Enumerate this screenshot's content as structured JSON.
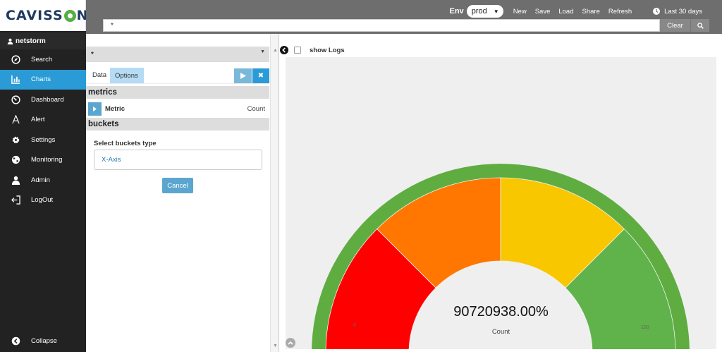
{
  "brand": {
    "name_left": "CAVISS",
    "name_right": "N"
  },
  "user": {
    "name": "netstorm"
  },
  "nav": {
    "items": [
      {
        "label": "Search",
        "icon": "compass-icon"
      },
      {
        "label": "Charts",
        "icon": "bar-chart-icon",
        "active": true
      },
      {
        "label": "Dashboard",
        "icon": "gauge-icon"
      },
      {
        "label": "Alert",
        "icon": "alert-icon"
      },
      {
        "label": "Settings",
        "icon": "gear-icon"
      },
      {
        "label": "Monitoring",
        "icon": "globe-icon"
      },
      {
        "label": "Admin",
        "icon": "user-icon"
      },
      {
        "label": "LogOut",
        "icon": "logout-icon"
      }
    ],
    "collapse_label": "Collapse"
  },
  "topbar": {
    "env_label": "Env",
    "env_value": "prod",
    "links": [
      "New",
      "Save",
      "Load",
      "Share",
      "Refresh"
    ],
    "time_range": "Last 30 days",
    "query_value": "*",
    "clear_label": "Clear"
  },
  "editor": {
    "title": "*",
    "tabs": {
      "data": "Data",
      "options": "Options"
    },
    "metrics_heading": "metrics",
    "metric_label": "Metric",
    "metric_agg": "Count",
    "buckets_heading": "buckets",
    "bucket_type_label": "Select buckets type",
    "bucket_option": "X-Axis",
    "cancel_label": "Cancel"
  },
  "viz": {
    "show_logs_label": "show Logs"
  },
  "chart_data": {
    "type": "gauge",
    "value_text": "90720938.00%",
    "label": "Count",
    "min_label": "0",
    "max_label": "100",
    "bands": [
      {
        "from": 0,
        "to": 25,
        "color": "#ff0000"
      },
      {
        "from": 25,
        "to": 50,
        "color": "#ff7700"
      },
      {
        "from": 50,
        "to": 75,
        "color": "#f8c700"
      },
      {
        "from": 75,
        "to": 100,
        "color": "#5fb34a"
      }
    ],
    "outline_color": "#5fad41"
  }
}
